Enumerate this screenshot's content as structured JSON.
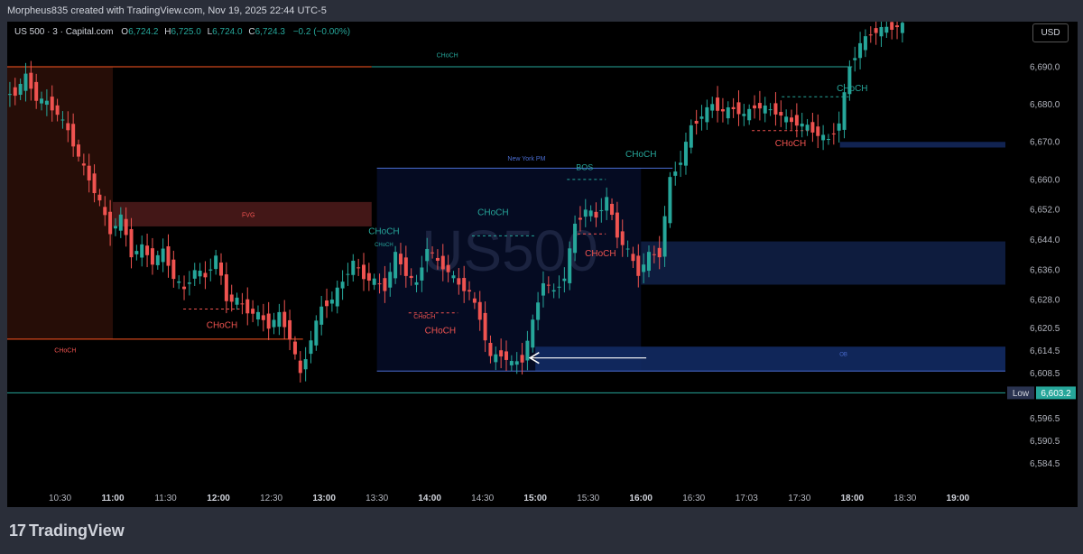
{
  "header": {
    "caption": "Morpheus835 created with TradingView.com, Nov 19, 2025 22:44 UTC-5"
  },
  "legend": {
    "symbol": "US 500 · 3 · Capital.com",
    "open_label": "O",
    "open": "6,724.2",
    "high_label": "H",
    "high": "6,725.0",
    "low_label": "L",
    "low": "6,724.0",
    "close_label": "C",
    "close": "6,724.3",
    "change": "−0.2 (−0.00%)"
  },
  "currency_button": "USD",
  "watermark": "US500",
  "footer": {
    "logo_mark": "17",
    "logo_text": "TradingView"
  },
  "chart_data": {
    "type": "candlestick",
    "ylim": [
      6580,
      6702
    ],
    "y_ticks": [
      {
        "value": 6690.0,
        "label": "6,690.0"
      },
      {
        "value": 6680.0,
        "label": "6,680.0"
      },
      {
        "value": 6670.0,
        "label": "6,670.0"
      },
      {
        "value": 6660.0,
        "label": "6,660.0"
      },
      {
        "value": 6652.0,
        "label": "6,652.0"
      },
      {
        "value": 6644.0,
        "label": "6,644.0"
      },
      {
        "value": 6636.0,
        "label": "6,636.0"
      },
      {
        "value": 6628.0,
        "label": "6,628.0"
      },
      {
        "value": 6620.5,
        "label": "6,620.5"
      },
      {
        "value": 6614.5,
        "label": "6,614.5"
      },
      {
        "value": 6608.5,
        "label": "6,608.5"
      },
      {
        "value": 6596.5,
        "label": "6,596.5"
      },
      {
        "value": 6590.5,
        "label": "6,590.5"
      },
      {
        "value": 6584.5,
        "label": "6,584.5"
      }
    ],
    "x_ticks": [
      "10:30",
      "11:00",
      "11:30",
      "12:00",
      "12:30",
      "13:00",
      "13:30",
      "14:00",
      "14:30",
      "15:00",
      "15:30",
      "16:00",
      "16:30",
      "17:03",
      "17:30",
      "18:00",
      "18:30",
      "19:00"
    ],
    "time_start": "10:00",
    "time_end": "19:27",
    "price_markers": [
      {
        "label": "Low",
        "value": 6603.2,
        "text": "6,603.2",
        "color": "#26a69a"
      }
    ],
    "zones": [
      {
        "label": "",
        "t0": "10:00",
        "t1": "11:00",
        "y0": 6617.5,
        "y1": 6690.0,
        "color": "#2a0e08"
      },
      {
        "label": "FVG",
        "t0": "11:00",
        "t1": "13:27",
        "y0": 6647.5,
        "y1": 6654.0,
        "color": "#4a1a1a"
      },
      {
        "label": "New York PM",
        "t0": "13:30",
        "t1": "16:00",
        "y0": 6609.0,
        "y1": 6663.0,
        "color": "#060c26"
      },
      {
        "label": "",
        "t0": "16:00",
        "t1": "19:27",
        "y0": 6632.0,
        "y1": 6643.5,
        "color": "#0f1f45"
      },
      {
        "label": "",
        "t0": "17:53",
        "t1": "19:27",
        "y0": 6668.5,
        "y1": 6670.0,
        "color": "#13275a"
      },
      {
        "label": "OB",
        "t0": "15:00",
        "t1": "19:27",
        "y0": 6609.0,
        "y1": 6615.5,
        "color": "#122a63"
      }
    ],
    "annotations": [
      {
        "text": "CHoCH",
        "t": "14:10",
        "y": 6692.5,
        "color": "#26a69a",
        "size": 7
      },
      {
        "text": "CHoCH",
        "t": "18:00",
        "y": 6683.5,
        "color": "#26a69a",
        "size": 10
      },
      {
        "text": "CHoCH",
        "t": "17:25",
        "y": 6668.8,
        "color": "#ef5350",
        "size": 10
      },
      {
        "text": "CHoCH",
        "t": "16:00",
        "y": 6666.0,
        "color": "#26a69a",
        "size": 10
      },
      {
        "text": "New York PM",
        "t": "14:55",
        "y": 6665.0,
        "color": "#4a6cd1",
        "size": 7
      },
      {
        "text": "BOS",
        "t": "15:28",
        "y": 6662.5,
        "color": "#26a69a",
        "size": 9
      },
      {
        "text": "CHoCH",
        "t": "14:36",
        "y": 6650.5,
        "color": "#26a69a",
        "size": 10
      },
      {
        "text": "CHoCH",
        "t": "13:34",
        "y": 6645.5,
        "color": "#26a69a",
        "size": 10
      },
      {
        "text": "CHoCH",
        "t": "13:34",
        "y": 6642.2,
        "color": "#26a69a",
        "size": 6
      },
      {
        "text": "CHoCH",
        "t": "15:37",
        "y": 6639.5,
        "color": "#ef5350",
        "size": 10
      },
      {
        "text": "FVG",
        "t": "12:17",
        "y": 6650.0,
        "color": "#ef5350",
        "size": 7
      },
      {
        "text": "CHoCH",
        "t": "12:02",
        "y": 6620.5,
        "color": "#ef5350",
        "size": 10
      },
      {
        "text": "CHoCH",
        "t": "13:57",
        "y": 6623.0,
        "color": "#ef5350",
        "size": 7
      },
      {
        "text": "CHoCH",
        "t": "14:06",
        "y": 6619.0,
        "color": "#ef5350",
        "size": 10
      },
      {
        "text": "CHoCH",
        "t": "10:33",
        "y": 6614.0,
        "color": "#ef5350",
        "size": 7
      },
      {
        "text": "OB",
        "t": "17:55",
        "y": 6613.0,
        "color": "#4a6cd1",
        "size": 6
      }
    ],
    "levels": [
      {
        "t0": "10:00",
        "t1": "13:27",
        "y": 6690.0,
        "color": "#ff5722",
        "dashed": false
      },
      {
        "t0": "13:27",
        "t1": "18:00",
        "y": 6690.0,
        "color": "#26a69a",
        "dashed": false
      },
      {
        "t0": "10:00",
        "t1": "12:48",
        "y": 6617.5,
        "color": "#ff5722",
        "dashed": false
      },
      {
        "t0": "10:00",
        "t1": "19:27",
        "y": 6603.2,
        "color": "#26a69a",
        "dashed": false
      },
      {
        "t0": "13:30",
        "t1": "16:18",
        "y": 6663.0,
        "color": "#4a6cd1",
        "dashed": false
      },
      {
        "t0": "13:30",
        "t1": "19:27",
        "y": 6609.0,
        "color": "#4a6cd1",
        "dashed": false
      },
      {
        "t0": "15:18",
        "t1": "15:40",
        "y": 6660.0,
        "color": "#26a69a",
        "dashed": true
      },
      {
        "t0": "17:20",
        "t1": "17:58",
        "y": 6682.0,
        "color": "#26a69a",
        "dashed": true
      },
      {
        "t0": "17:03",
        "t1": "17:40",
        "y": 6673.0,
        "color": "#ef5350",
        "dashed": true
      },
      {
        "t0": "11:40",
        "t1": "12:12",
        "y": 6625.5,
        "color": "#ef5350",
        "dashed": true
      },
      {
        "t0": "13:48",
        "t1": "14:16",
        "y": 6624.5,
        "color": "#ef5350",
        "dashed": true
      },
      {
        "t0": "14:24",
        "t1": "15:00",
        "y": 6645.0,
        "color": "#26a69a",
        "dashed": true
      },
      {
        "t0": "15:24",
        "t1": "15:40",
        "y": 6645.5,
        "color": "#ef5350",
        "dashed": true
      }
    ],
    "arrow": {
      "t0": "16:03",
      "t1": "14:57",
      "y": 6612.5,
      "color": "#ffffff"
    },
    "ohlc_path": [
      [
        "10:00",
        6682.5
      ],
      [
        "10:06",
        6683.0
      ],
      [
        "10:12",
        6687.5
      ],
      [
        "10:18",
        6681.5
      ],
      [
        "10:24",
        6680.5
      ],
      [
        "10:30",
        6677.5
      ],
      [
        "10:36",
        6673.0
      ],
      [
        "10:42",
        6666.0
      ],
      [
        "10:48",
        6660.0
      ],
      [
        "10:54",
        6654.0
      ],
      [
        "11:00",
        6646.0
      ],
      [
        "11:06",
        6650.0
      ],
      [
        "11:12",
        6640.0
      ],
      [
        "11:18",
        6642.0
      ],
      [
        "11:24",
        6638.0
      ],
      [
        "11:30",
        6641.0
      ],
      [
        "11:36",
        6634.0
      ],
      [
        "11:42",
        6630.5
      ],
      [
        "11:48",
        6636.0
      ],
      [
        "11:54",
        6634.0
      ],
      [
        "12:00",
        6639.5
      ],
      [
        "12:06",
        6628.0
      ],
      [
        "12:12",
        6628.0
      ],
      [
        "12:18",
        6625.0
      ],
      [
        "12:24",
        6624.0
      ],
      [
        "12:30",
        6621.0
      ],
      [
        "12:36",
        6624.0
      ],
      [
        "12:42",
        6618.0
      ],
      [
        "12:48",
        6608.0
      ],
      [
        "12:54",
        6617.5
      ],
      [
        "13:00",
        6626.0
      ],
      [
        "13:06",
        6628.0
      ],
      [
        "13:12",
        6633.0
      ],
      [
        "13:18",
        6638.0
      ],
      [
        "13:24",
        6634.0
      ],
      [
        "13:30",
        6633.0
      ],
      [
        "13:36",
        6631.0
      ],
      [
        "13:42",
        6640.0
      ],
      [
        "13:48",
        6635.0
      ],
      [
        "13:54",
        6632.0
      ],
      [
        "14:00",
        6642.0
      ],
      [
        "14:06",
        6638.0
      ],
      [
        "14:12",
        6635.5
      ],
      [
        "14:18",
        6632.0
      ],
      [
        "14:24",
        6630.0
      ],
      [
        "14:30",
        6623.0
      ],
      [
        "14:36",
        6612.5
      ],
      [
        "14:42",
        6613.5
      ],
      [
        "14:48",
        6611.0
      ],
      [
        "14:54",
        6612.0
      ],
      [
        "15:00",
        6622.0
      ],
      [
        "15:06",
        6633.0
      ],
      [
        "15:12",
        6630.0
      ],
      [
        "15:18",
        6634.0
      ],
      [
        "15:24",
        6648.0
      ],
      [
        "15:30",
        6652.0
      ],
      [
        "15:36",
        6650.0
      ],
      [
        "15:42",
        6655.0
      ],
      [
        "15:48",
        6645.0
      ],
      [
        "15:54",
        6641.0
      ],
      [
        "16:00",
        6635.0
      ],
      [
        "16:06",
        6640.0
      ],
      [
        "16:12",
        6640.0
      ],
      [
        "16:18",
        6660.0
      ],
      [
        "16:24",
        6665.0
      ],
      [
        "16:30",
        6674.0
      ],
      [
        "16:36",
        6677.0
      ],
      [
        "16:42",
        6680.0
      ],
      [
        "16:48",
        6678.0
      ],
      [
        "16:54",
        6679.0
      ],
      [
        "17:00",
        6677.0
      ],
      [
        "17:06",
        6679.5
      ],
      [
        "17:12",
        6679.0
      ],
      [
        "17:18",
        6678.0
      ],
      [
        "17:24",
        6676.0
      ],
      [
        "17:30",
        6675.0
      ],
      [
        "17:36",
        6674.0
      ],
      [
        "17:42",
        6672.0
      ],
      [
        "17:48",
        6670.5
      ],
      [
        "17:54",
        6675.0
      ],
      [
        "18:00",
        6690.0
      ],
      [
        "18:06",
        6696.0
      ],
      [
        "18:12",
        6699.0
      ],
      [
        "18:18",
        6700.0
      ],
      [
        "18:24",
        6700.5
      ],
      [
        "18:30",
        6701.0
      ]
    ]
  }
}
